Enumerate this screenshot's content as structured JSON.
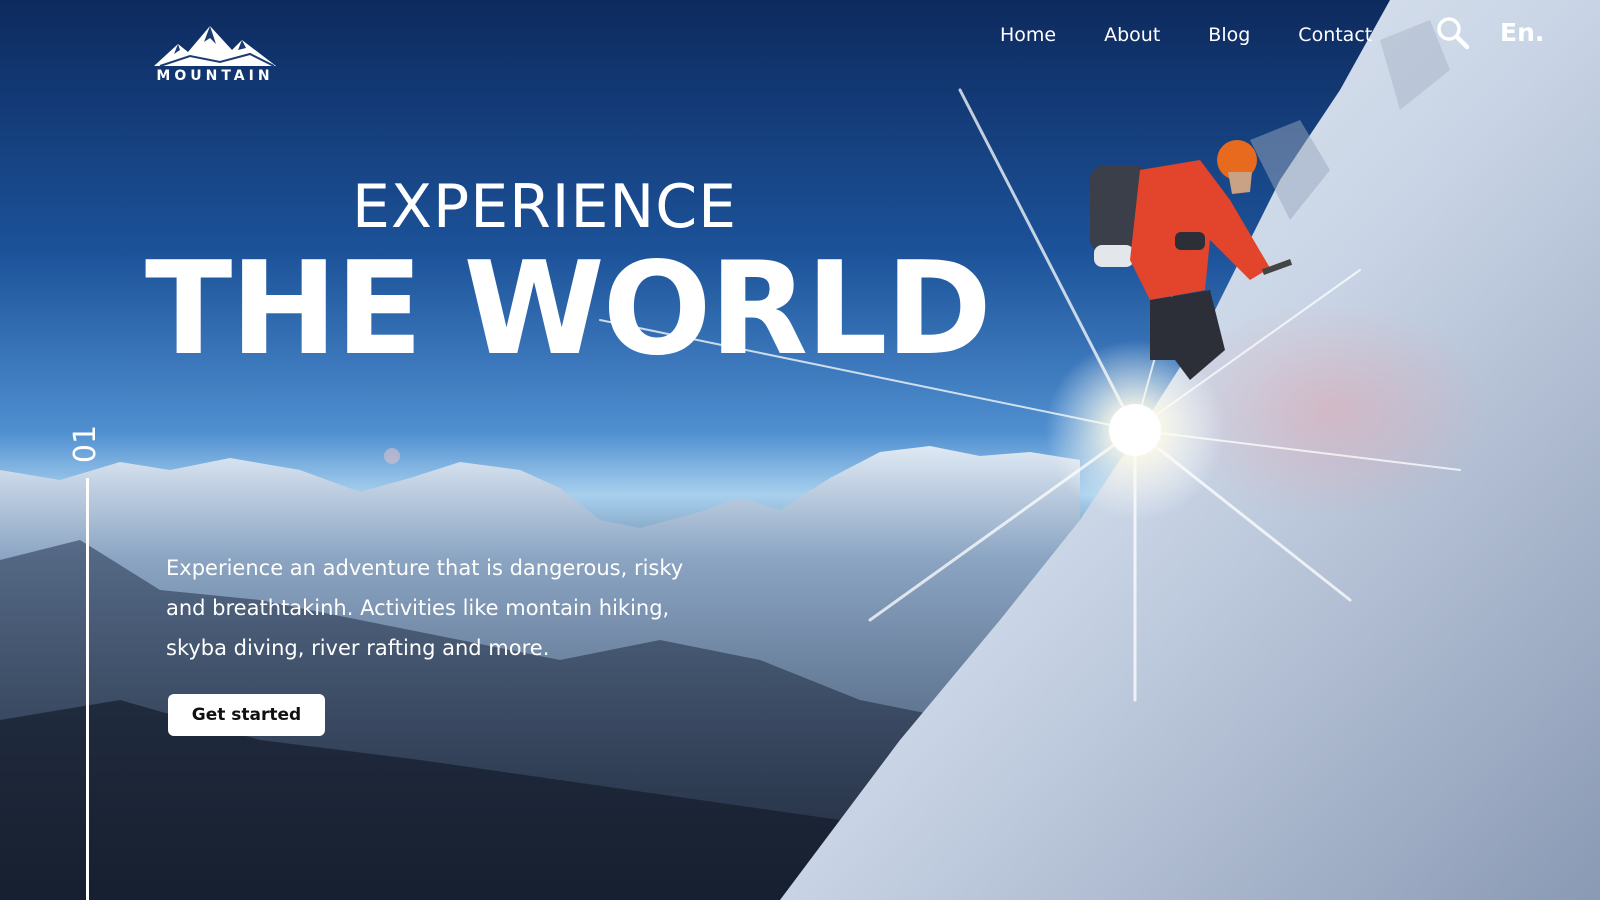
{
  "brand": {
    "logo_text": "MOUNTAIN"
  },
  "nav": {
    "items": [
      {
        "label": "Home"
      },
      {
        "label": "About"
      },
      {
        "label": "Blog"
      },
      {
        "label": "Contact"
      }
    ],
    "search_icon": "search-icon",
    "language": "En."
  },
  "hero": {
    "kicker": "EXPERIENCE",
    "headline": "THE WORLD",
    "slide_number": "01",
    "description": "Experience an adventure that is dangerous, risky and breathtakinh. Activities like montain hiking, skyba diving, river rafting and more.",
    "cta_label": "Get started"
  }
}
